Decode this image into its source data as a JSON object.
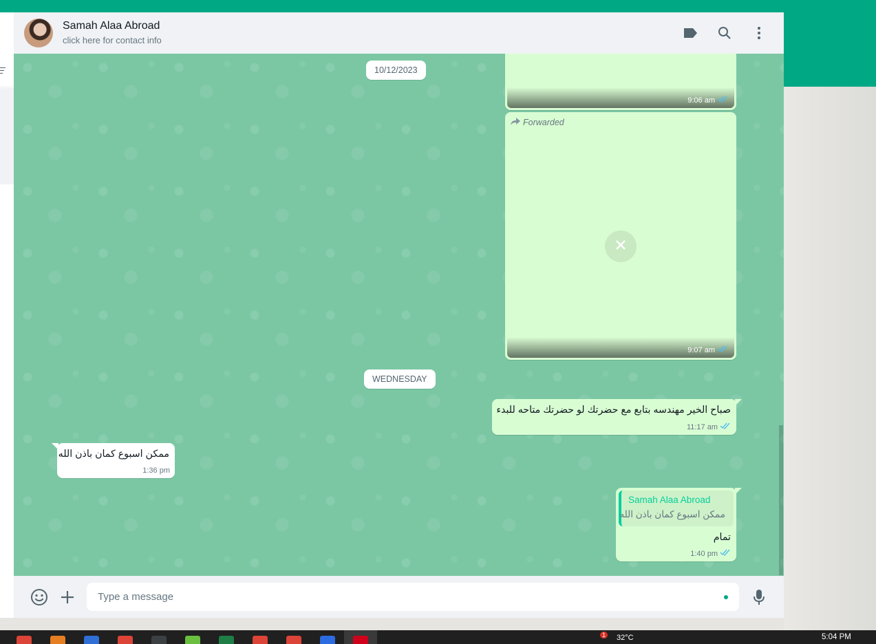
{
  "contact": {
    "name": "Samah Alaa Abroad",
    "subtitle": "click here for contact info"
  },
  "header_icons": [
    "label-icon",
    "search-icon",
    "menu-icon"
  ],
  "messages_area": {
    "date_1": "10/12/2023",
    "media_1_time": "9:06 am",
    "forwarded_label": "Forwarded",
    "media_2_time": "9:07 am",
    "date_2": "WEDNESDAY",
    "msg_1": {
      "text": "صباح الخير مهندسه بتابع مع حضرتك لو حضرتك متاحه للبدء",
      "time": "11:17 am",
      "direction": "outgoing"
    },
    "msg_2": {
      "text": "ممكن اسبوع كمان باذن الله",
      "time": "1:36 pm",
      "direction": "incoming"
    },
    "msg_3": {
      "quoted_author": "Samah Alaa Abroad",
      "quoted_text": "ممكن اسبوع كمان باذن الله",
      "text": "تمام",
      "time": "1:40 pm",
      "direction": "outgoing"
    }
  },
  "composer": {
    "placeholder": "Type a message"
  },
  "taskbar": {
    "time": "5:04 PM",
    "notification_count": "1",
    "weather": "32°C"
  },
  "colors": {
    "brand": "#00a884",
    "outgoing_bubble": "#d9fdd3",
    "read_tick": "#53bdeb",
    "chat_background": "#7bc7a4"
  }
}
